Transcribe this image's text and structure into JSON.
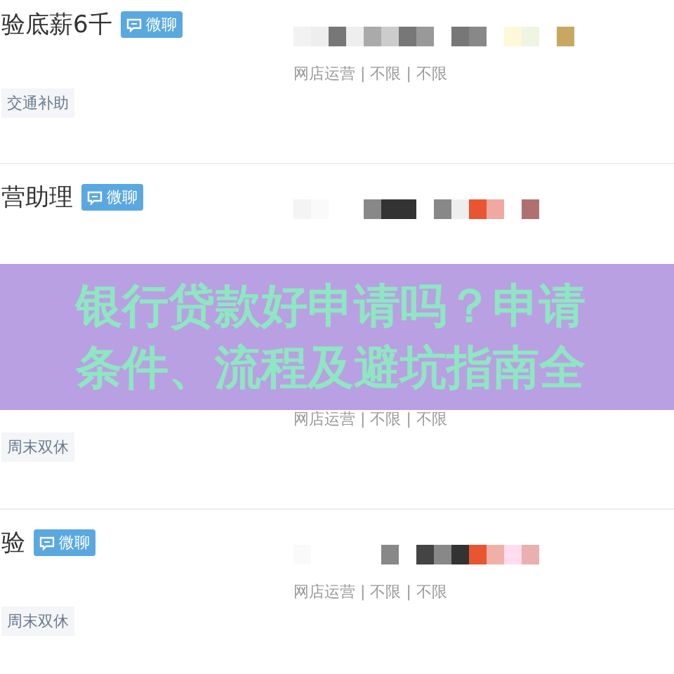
{
  "listings": [
    {
      "title": "验底薪6千",
      "chat_badge": "微聊",
      "tags": [
        "交通补助"
      ],
      "info": "网店运营 | 不限 | 不限"
    },
    {
      "title": "营助理",
      "chat_badge": "微聊"
    },
    {
      "tags": [
        "周末双休"
      ],
      "info": "网店运营 | 不限 | 不限"
    },
    {
      "title": "验",
      "chat_badge": "微聊",
      "tags": [
        "周末双休"
      ],
      "info": "网店运营 | 不限 | 不限"
    }
  ],
  "banner": {
    "title": "银行贷款好申请吗？申请条件、流程及避坑指南全"
  }
}
